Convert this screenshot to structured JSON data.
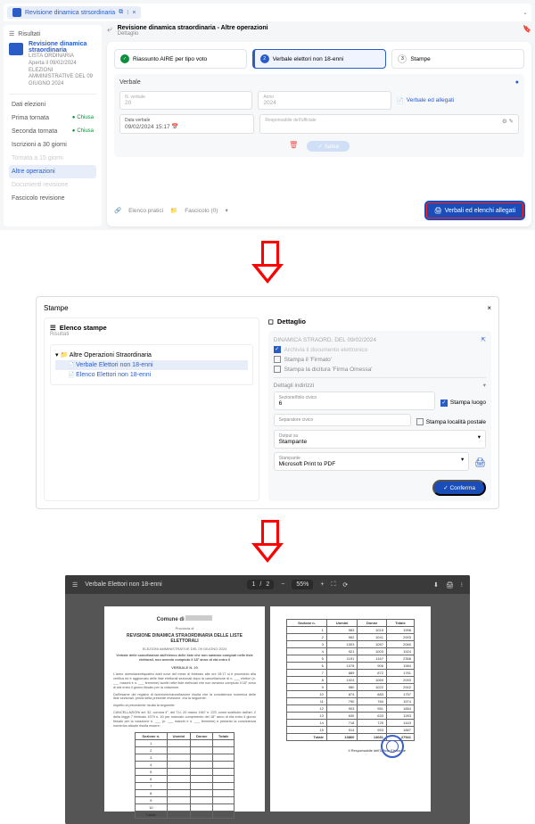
{
  "tab": {
    "title": "Revisione dinamica strsordinaria",
    "copy": "⧉",
    "tools": "⁝",
    "close": "×"
  },
  "results_label": "Risultati",
  "sidebar": {
    "title": "Revisione dinamica straordinaria",
    "sub1": "LISTA ORDINARIA",
    "sub2": "Aperta il 09/02/2024",
    "sub3": "ELEZIONI AMMINISTRATIVE DEL 09 GIUGNO 2024",
    "items": [
      {
        "label": "Dati elezioni"
      },
      {
        "label": "Prima tornata",
        "status": "Chiusa"
      },
      {
        "label": "Seconda tornata",
        "status": "Chiusa"
      },
      {
        "label": "Iscrizioni a 30 giorni"
      },
      {
        "label": "Tornata a 15 giorni",
        "disabled": true
      },
      {
        "label": "Altre operazioni",
        "selected": true
      },
      {
        "label": "Documenti revisione",
        "disabled": true
      },
      {
        "label": "Fascicolo revisione"
      }
    ]
  },
  "content": {
    "title": "Revisione dinamica straordinaria - Altre operazioni",
    "sub": "Dettaglio",
    "steps": [
      {
        "n": "✓",
        "label": "Riassunto AIRE per tipo voto",
        "cls": "done"
      },
      {
        "n": "2",
        "label": "Verbale elettori non 18-enni",
        "cls": "active"
      },
      {
        "n": "3",
        "label": "Stampe",
        "cls": ""
      }
    ],
    "section": "Verbale",
    "fields": {
      "num": "N. verbale",
      "numv": "20",
      "anno": "Anno",
      "annov": "2024",
      "data": "Data verbale",
      "datav": "09/02/2024 15:17",
      "resp": "Responsabile dell'ufficiale",
      "respv": ""
    },
    "attach": "Verbale ed allegati",
    "save": "Salva",
    "footer_link": "Elenco pratici",
    "footer_fasc": "Fascicolo (0)",
    "blue_btn": "Verbali ed elenchi allegati"
  },
  "panel2": {
    "title": "Stampe",
    "left_head": "Elenco stampe",
    "left_sub": "Risultati",
    "tree_root": "Altre Operazioni Straordinaria",
    "tree_items": [
      "Verbale Elettori non 18-enni",
      "Elenco Elettori non 18-enni"
    ],
    "right_head": "Dettaglio",
    "ref": "DINAMICA STRAORD. DEL 09/02/2024",
    "chk1": "Archivia il documento elettronico",
    "chk2": "Stampa il 'Firmato'",
    "chk3": "Stampa la dicitura 'Firma Omessa'",
    "det_sec": "Dettagli indirizzi",
    "sez1_lab": "Sezione/folio civico",
    "sez1_val": "6",
    "sez2_lab": "Separatore civico",
    "sez2_val": "",
    "stampa_lungo": "Stampa luogo",
    "stampa_loc": "Stampa località postale",
    "out_lab": "Output su",
    "out_val": "Stampante",
    "stamp_lab": "Stampante",
    "stamp_val": "Microsoft Print to PDF",
    "confirm": "Conferma"
  },
  "panel3": {
    "tab": "Verbale Elettori non 18-enni",
    "page": "1",
    "total": "2",
    "zoom": "55%",
    "doc": {
      "comune": "Comune di",
      "prov": "Provincia di",
      "h1": "REVISIONE DINAMICA STRAORDINARIA DELLE LISTE ELETTORALI",
      "h1sub": "ELEZIONI AMMINISTRATIVE DEL 09 GIUGNO 2024",
      "h2": "Verbale delle cancellazioni dall'elenco delle liste che non saranno compiuti nelle liste elettorali, non avendo compiuto il 18° anno di età entro il",
      "verb": "VERBALE N. 20",
      "tbl_head": [
        "Sezione n.",
        "Uomini",
        "Donne",
        "Totale"
      ]
    }
  },
  "chart_data": {
    "type": "table",
    "title": "Sezione / Uomini / Donne / Totale",
    "columns": [
      "Sezione n.",
      "Uomini",
      "Donne",
      "Totale"
    ],
    "rows": [
      [
        1,
        983,
        1015,
        1998
      ],
      [
        2,
        962,
        1041,
        2003
      ],
      [
        3,
        1003,
        1057,
        2060
      ],
      [
        4,
        921,
        1003,
        1924
      ],
      [
        5,
        1191,
        1167,
        2358
      ],
      [
        6,
        1078,
        906,
        1984
      ],
      [
        7,
        889,
        872,
        1761
      ],
      [
        8,
        1024,
        1069,
        2093
      ],
      [
        9,
        980,
        1022,
        2002
      ],
      [
        10,
        874,
        883,
        1757
      ],
      [
        11,
        790,
        784,
        1574
      ],
      [
        12,
        903,
        951,
        1854
      ],
      [
        13,
        630,
        633,
        1263
      ],
      [
        14,
        718,
        725,
        1443
      ],
      [
        15,
        914,
        953,
        1867
      ]
    ],
    "totals": [
      "Totale",
      13860,
      14081,
      27941
    ]
  }
}
